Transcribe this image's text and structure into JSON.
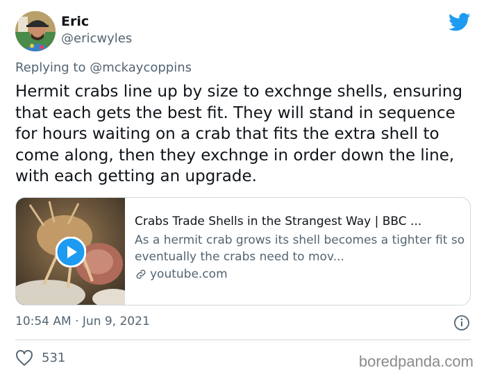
{
  "author": {
    "name": "Eric",
    "handle": "@ericwyles"
  },
  "reply": {
    "prefix": "Replying to",
    "mention": "@mckaycoppins"
  },
  "tweet": {
    "text": "Hermit crabs line up by size to exchnge shells, ensuring that each gets the best fit. They will stand in sequence for hours waiting on a crab that fits the extra shell to come along, then they exchnge in order down the line, with each getting an upgrade."
  },
  "card": {
    "title": "Crabs Trade Shells in the Strangest Way | BBC ...",
    "description": "As a hermit crab grows its shell becomes a tighter fit so eventually the crabs need to mov...",
    "domain": "youtube.com",
    "play_icon": "play-icon",
    "link_icon": "link-icon"
  },
  "meta": {
    "timestamp": "10:54 AM · Jun 9, 2021",
    "likes": "531"
  },
  "watermark": "boredpanda.com",
  "colors": {
    "twitter_blue": "#1d9bf0",
    "text_primary": "#0f1419",
    "text_secondary": "#536471",
    "border": "#cfd9de"
  }
}
